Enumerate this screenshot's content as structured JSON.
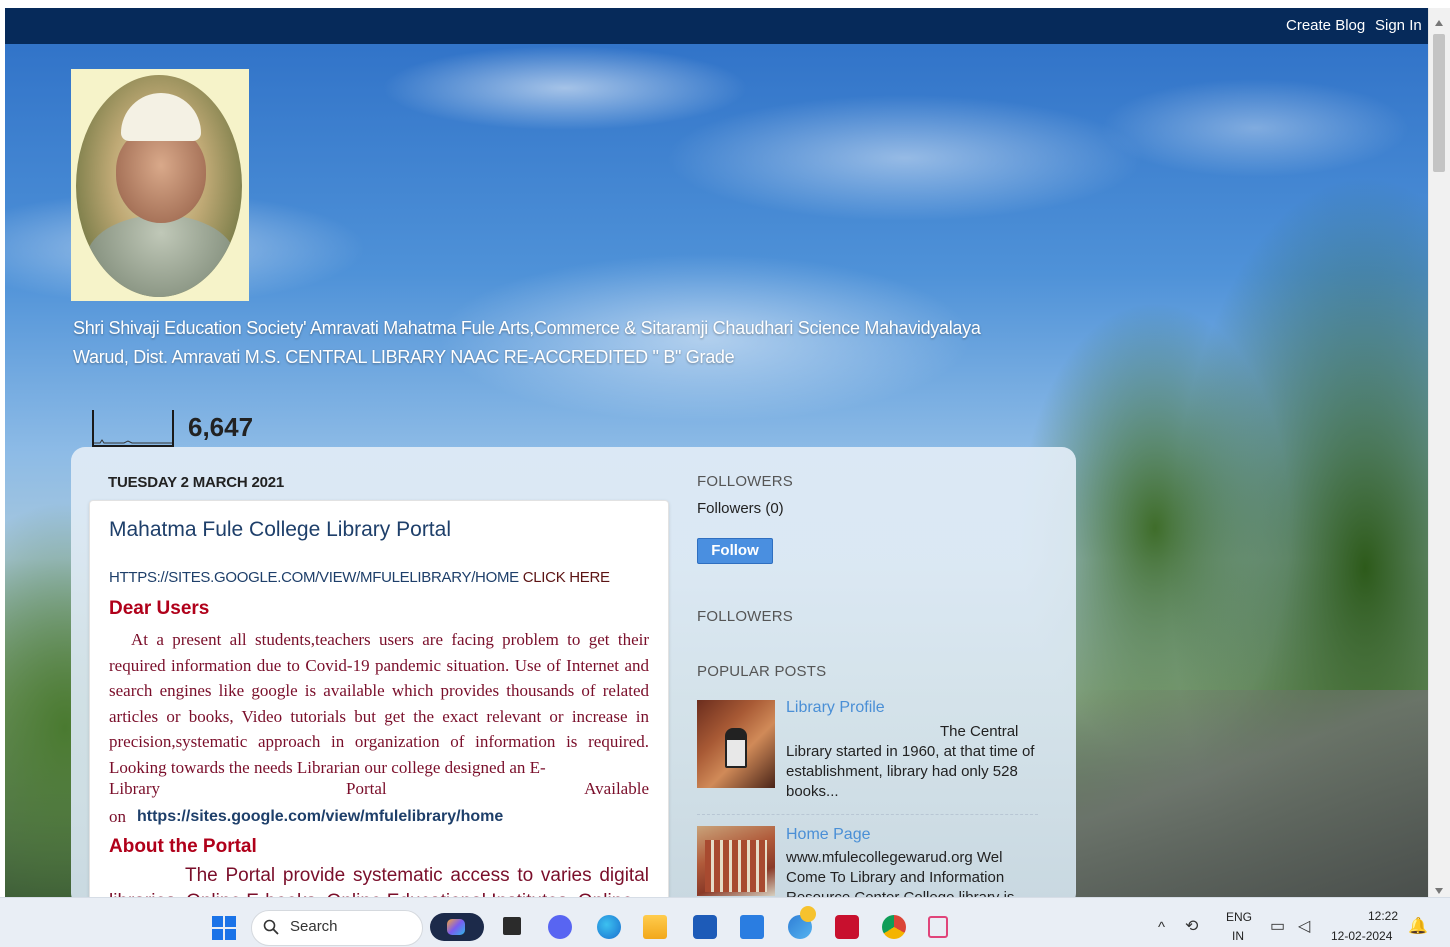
{
  "topbar": {
    "create_blog": "Create Blog",
    "sign_in": "Sign In"
  },
  "header": {
    "title_line1": "Shri Shivaji Education Society' Amravati Mahatma Fule Arts,Commerce & Sitaramji Chaudhari Science Mahavidyalaya",
    "title_line2": "Warud, Dist. Amravati M.S. CENTRAL LIBRARY NAAC RE-ACCREDITED \" B\" Grade"
  },
  "pageviews": {
    "count": "6,647"
  },
  "post": {
    "date": "TUESDAY 2 MARCH 2021",
    "title": "Mahatma Fule College Library Portal",
    "url_text": "HTTPS://SITES.GOOGLE.COM/VIEW/MFULELIBRARY/HOME",
    "url_label": " CLICK HERE",
    "dear_users": "Dear  Users",
    "body": "At a present all students,teachers  users are facing problem to get their required information due to Covid-19 pandemic situation. Use of Internet and search engines like google is available which provides thousands of related articles or books, Video tutorials but get the exact relevant or increase in precision,systematic approach in organization of information is required. Looking towards the needs Librarian our college designed an E-",
    "available_words": [
      "Library",
      "Portal",
      "Available"
    ],
    "available_on": "on",
    "available_link": "https://sites.google.com/view/mfulelibrary/home",
    "about_heading": "About the Portal",
    "about_body": "The Portal provide systematic access to varies digital libraries, Online E-books, Online Educational Institutes, Online"
  },
  "sidebar": {
    "followers_heading": "FOLLOWERS",
    "followers_count": "Followers (0)",
    "follow_button": "Follow",
    "followers_heading2": "FOLLOWERS",
    "popular_heading": "POPULAR POSTS",
    "popular_posts": [
      {
        "title": "Library Profile",
        "snippet_lead": "The Central",
        "snippet_rest": "Library started in 1960, at that time of establishment, library had only 528 books..."
      },
      {
        "title": "Home Page",
        "snippet": "www.mfulecollegewarud.org Wel Come To Library and Information Resource Center College library is"
      }
    ]
  },
  "taskbar": {
    "search_label": "Search",
    "lang_line1": "ENG",
    "lang_line2": "IN",
    "time": "12:22",
    "date": "12-02-2024"
  }
}
